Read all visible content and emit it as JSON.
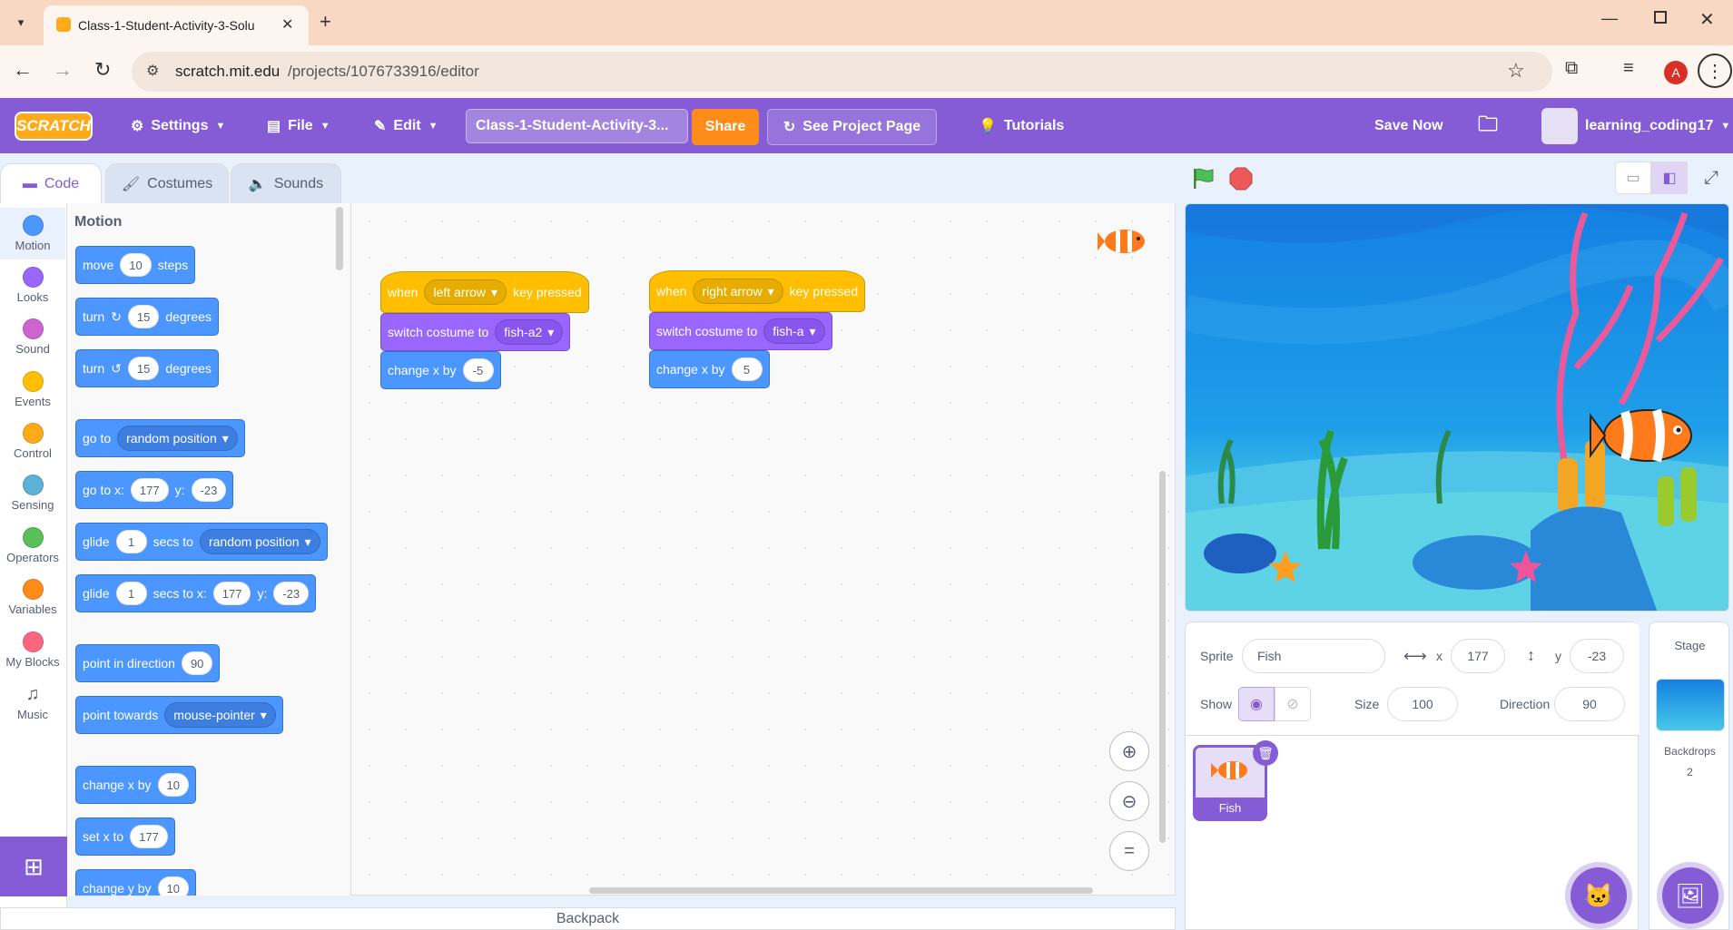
{
  "browser": {
    "tab_title": "Class-1-Student-Activity-3-Solu",
    "url_host": "scratch.mit.edu",
    "url_path": "/projects/1076733916/editor",
    "profile_initial": "A"
  },
  "menubar": {
    "logo": "SCRATCH",
    "settings": "Settings",
    "file": "File",
    "edit": "Edit",
    "project_title": "Class-1-Student-Activity-3...",
    "share": "Share",
    "see_project": "See Project Page",
    "tutorials": "Tutorials",
    "save_now": "Save Now",
    "username": "learning_coding17"
  },
  "editor_tabs": [
    "Code",
    "Costumes",
    "Sounds"
  ],
  "categories": [
    {
      "label": "Motion",
      "color": "#4c97ff"
    },
    {
      "label": "Looks",
      "color": "#9966ff"
    },
    {
      "label": "Sound",
      "color": "#cf63cf"
    },
    {
      "label": "Events",
      "color": "#ffbf00"
    },
    {
      "label": "Control",
      "color": "#ffab19"
    },
    {
      "label": "Sensing",
      "color": "#5cb1d6"
    },
    {
      "label": "Operators",
      "color": "#59c059"
    },
    {
      "label": "Variables",
      "color": "#ff8c1a"
    },
    {
      "label": "My Blocks",
      "color": "#ff6680"
    },
    {
      "label": "Music",
      "color": "#0fbd8c"
    }
  ],
  "palette": {
    "heading": "Motion",
    "move": {
      "a": "move",
      "v": "10",
      "b": "steps"
    },
    "turn_right": {
      "a": "turn",
      "v": "15",
      "b": "degrees"
    },
    "turn_left": {
      "a": "turn",
      "v": "15",
      "b": "degrees"
    },
    "go_to": {
      "a": "go to",
      "d": "random position"
    },
    "go_to_xy": {
      "a": "go to x:",
      "x": "177",
      "b": "y:",
      "y": "-23"
    },
    "glide_to": {
      "a": "glide",
      "v": "1",
      "b": "secs to",
      "d": "random position"
    },
    "glide_xy": {
      "a": "glide",
      "v": "1",
      "b": "secs to x:",
      "x": "177",
      "c": "y:",
      "y": "-23"
    },
    "point_dir": {
      "a": "point in direction",
      "v": "90"
    },
    "point_towards": {
      "a": "point towards",
      "d": "mouse-pointer"
    },
    "change_x": {
      "a": "change x by",
      "v": "10"
    },
    "set_x": {
      "a": "set x to",
      "v": "177"
    },
    "change_y": {
      "a": "change y by",
      "v": "10"
    }
  },
  "scripts": {
    "left": {
      "when": "when",
      "key": "left arrow",
      "pressed": "key pressed",
      "switch": "switch costume to",
      "costume": "fish-a2",
      "change": "change x by",
      "value": "-5"
    },
    "right": {
      "when": "when",
      "key": "right arrow",
      "pressed": "key pressed",
      "switch": "switch costume to",
      "costume": "fish-a",
      "change": "change x by",
      "value": "5"
    }
  },
  "sprite_info": {
    "sprite_label": "Sprite",
    "sprite_name": "Fish",
    "x_label": "x",
    "x": "177",
    "y_label": "y",
    "y": "-23",
    "show_label": "Show",
    "size_label": "Size",
    "size": "100",
    "direction_label": "Direction",
    "direction": "90"
  },
  "sprites": [
    {
      "name": "Fish"
    }
  ],
  "stage_pane": {
    "title": "Stage",
    "backdrops_label": "Backdrops",
    "backdrops_count": "2"
  },
  "backpack": "Backpack",
  "colors": {
    "scratch_purple": "#855cd6",
    "share_orange": "#ff8c1a",
    "motion": "#4c97ff",
    "looks": "#9966ff",
    "events": "#ffbf00"
  }
}
